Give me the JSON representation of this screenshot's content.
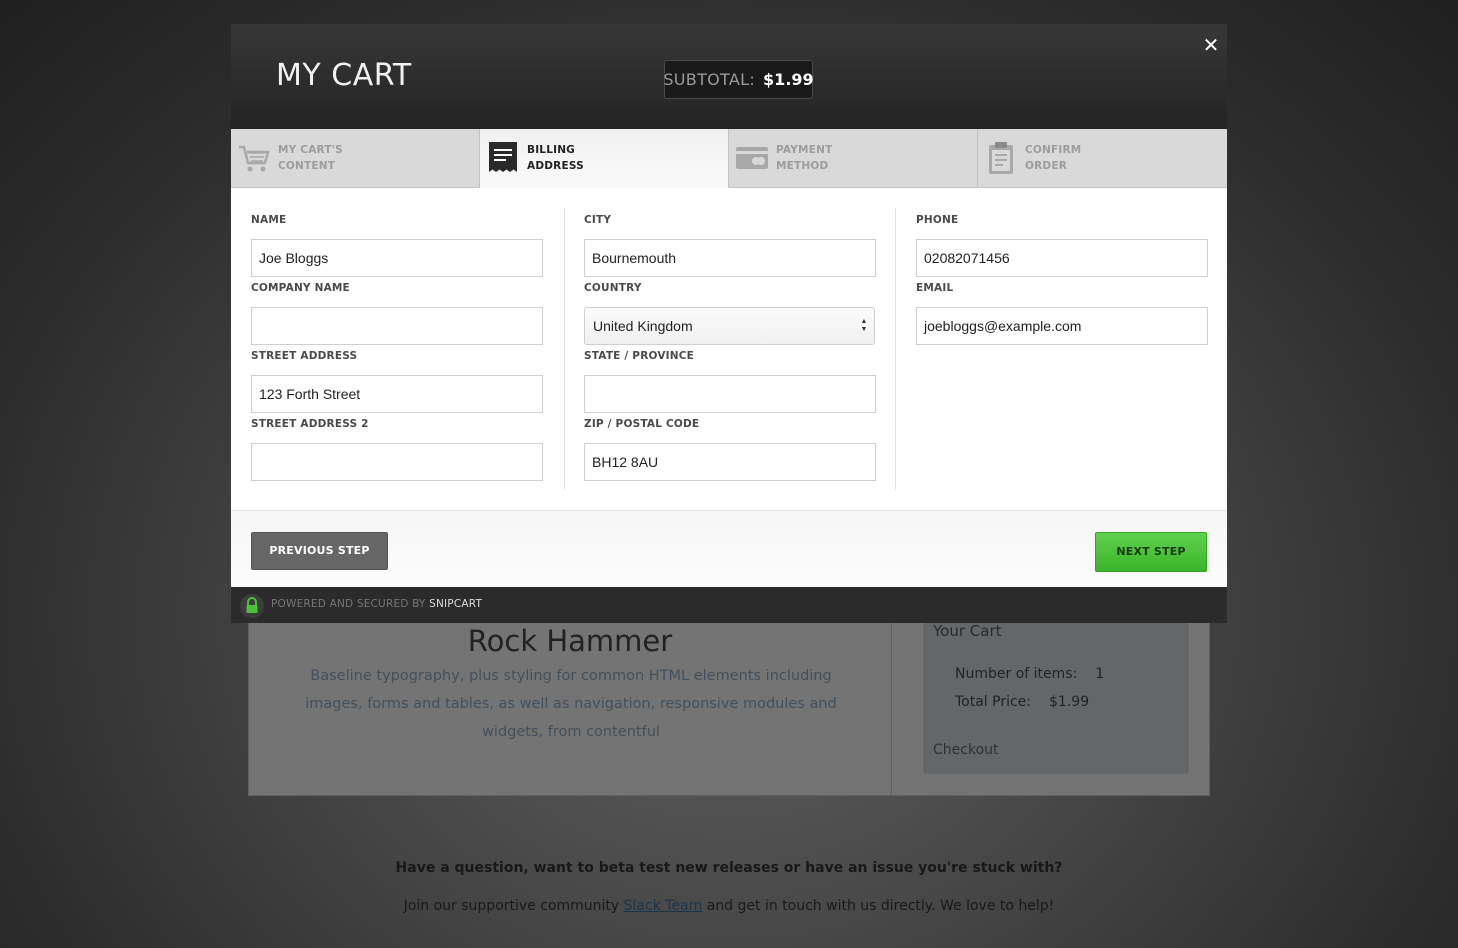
{
  "modal": {
    "title": "MY CART",
    "subtotal_label": "SUBTOTAL:",
    "subtotal_value": "$1.99",
    "close_glyph": "✕",
    "steps": [
      {
        "line1": "MY CART'S",
        "line2": "CONTENT",
        "icon": "cart-icon",
        "active": false
      },
      {
        "line1": "BILLING",
        "line2": "ADDRESS",
        "icon": "receipt-icon",
        "active": true
      },
      {
        "line1": "PAYMENT",
        "line2": "METHOD",
        "icon": "credit-card-icon",
        "active": false
      },
      {
        "line1": "CONFIRM",
        "line2": "ORDER",
        "icon": "clipboard-icon",
        "active": false
      }
    ],
    "form": {
      "name": {
        "label": "NAME",
        "value": "Joe Bloggs"
      },
      "company": {
        "label": "COMPANY NAME",
        "value": ""
      },
      "street": {
        "label": "STREET ADDRESS",
        "value": "123 Forth Street"
      },
      "street2": {
        "label": "STREET ADDRESS 2",
        "value": ""
      },
      "city": {
        "label": "CITY",
        "value": "Bournemouth"
      },
      "country": {
        "label": "COUNTRY",
        "value": "United Kingdom"
      },
      "state": {
        "label": "STATE / PROVINCE",
        "value": ""
      },
      "zip": {
        "label": "ZIP / POSTAL CODE",
        "value": "BH12 8AU"
      },
      "phone": {
        "label": "PHONE",
        "value": "02082071456"
      },
      "email": {
        "label": "EMAIL",
        "value": "joebloggs@example.com"
      }
    },
    "prev_label": "PREVIOUS STEP",
    "next_label": "NEXT STEP",
    "powered_prefix": "POWERED AND SECURED BY",
    "powered_brand": "SNIPCART"
  },
  "background": {
    "product_title": "Rock Hammer",
    "product_desc": "Baseline typography, plus styling for common HTML elements including images, forms and tables, as well as navigation, responsive modules and widgets, from contentful",
    "cart_title": "Your Cart",
    "items_label": "Number of items:",
    "items_value": "1",
    "total_label": "Total Price:",
    "total_value": "$1.99",
    "checkout_label": "Checkout",
    "question": "Have a question, want to beta test new releases or have an issue you're stuck with?",
    "join_prefix": "Join our supportive community",
    "join_link": "Slack Team",
    "join_suffix": "and get in touch with us directly. We love to help!"
  },
  "colors": {
    "next_button": "#4cc23a",
    "prev_button": "#666666",
    "header": "#2a2a2a"
  }
}
